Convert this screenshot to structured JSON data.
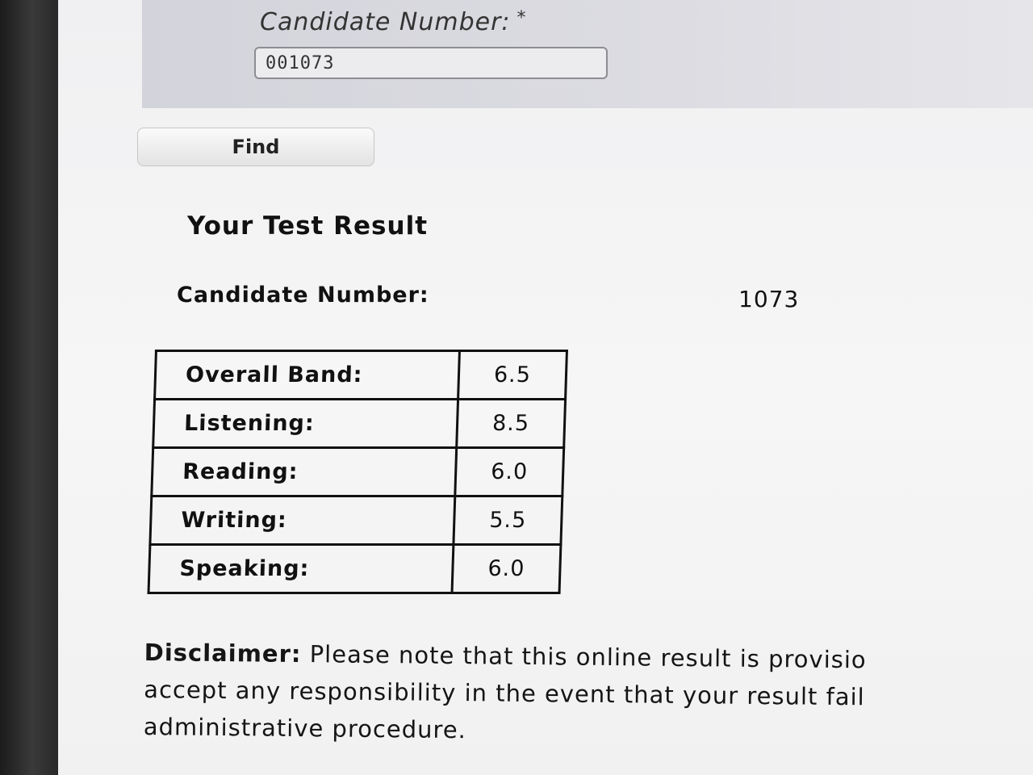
{
  "form": {
    "field_label": "Candidate Number:",
    "required_mark": "*",
    "candidate_input_value": "001073",
    "find_button_label": "Find"
  },
  "result": {
    "title": "Your Test Result",
    "candidate_label": "Candidate Number:",
    "candidate_value": "1073",
    "scores": [
      {
        "label": "Overall Band:",
        "value": "6.5"
      },
      {
        "label": "Listening:",
        "value": "8.5"
      },
      {
        "label": "Reading:",
        "value": "6.0"
      },
      {
        "label": "Writing:",
        "value": "5.5"
      },
      {
        "label": "Speaking:",
        "value": "6.0"
      }
    ]
  },
  "disclaimer": {
    "label": "Disclaimer:",
    "line1": " Please note that this online result is provisio",
    "line2": "accept any responsibility in the event that your result fail",
    "line3": "administrative procedure."
  }
}
